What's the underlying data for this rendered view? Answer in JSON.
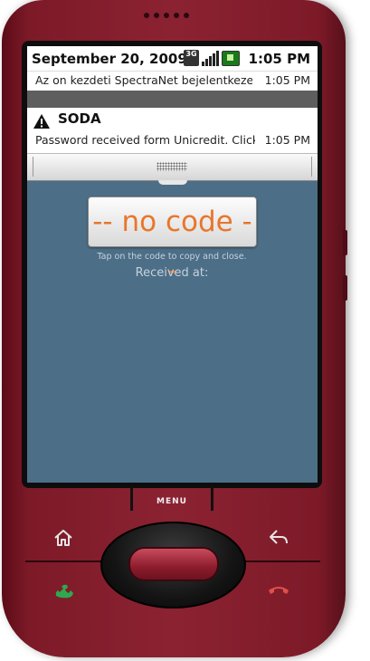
{
  "status_bar": {
    "date": "September 20, 2009",
    "time": "1:05 PM",
    "network_label": "3G"
  },
  "ticker": {
    "message": "Az on kezdeti SpectraNet bejelentkezes",
    "time": "1:05 PM"
  },
  "notification": {
    "icon": "warning-icon",
    "title": "SODA",
    "text": "Password received form Unicredit. Click",
    "time": "1:05 PM"
  },
  "app": {
    "code_button_label": "-- no code --",
    "hint": "Tap on the code to copy and close.",
    "received_label": "Received at:"
  },
  "hardware": {
    "menu_label": "MENU",
    "buttons": [
      "home-icon",
      "back-icon",
      "call-icon",
      "end-call-icon"
    ]
  },
  "colors": {
    "phone_body": "#8b2232",
    "screen_background": "#4d6e87",
    "code_text": "#e8762c"
  }
}
